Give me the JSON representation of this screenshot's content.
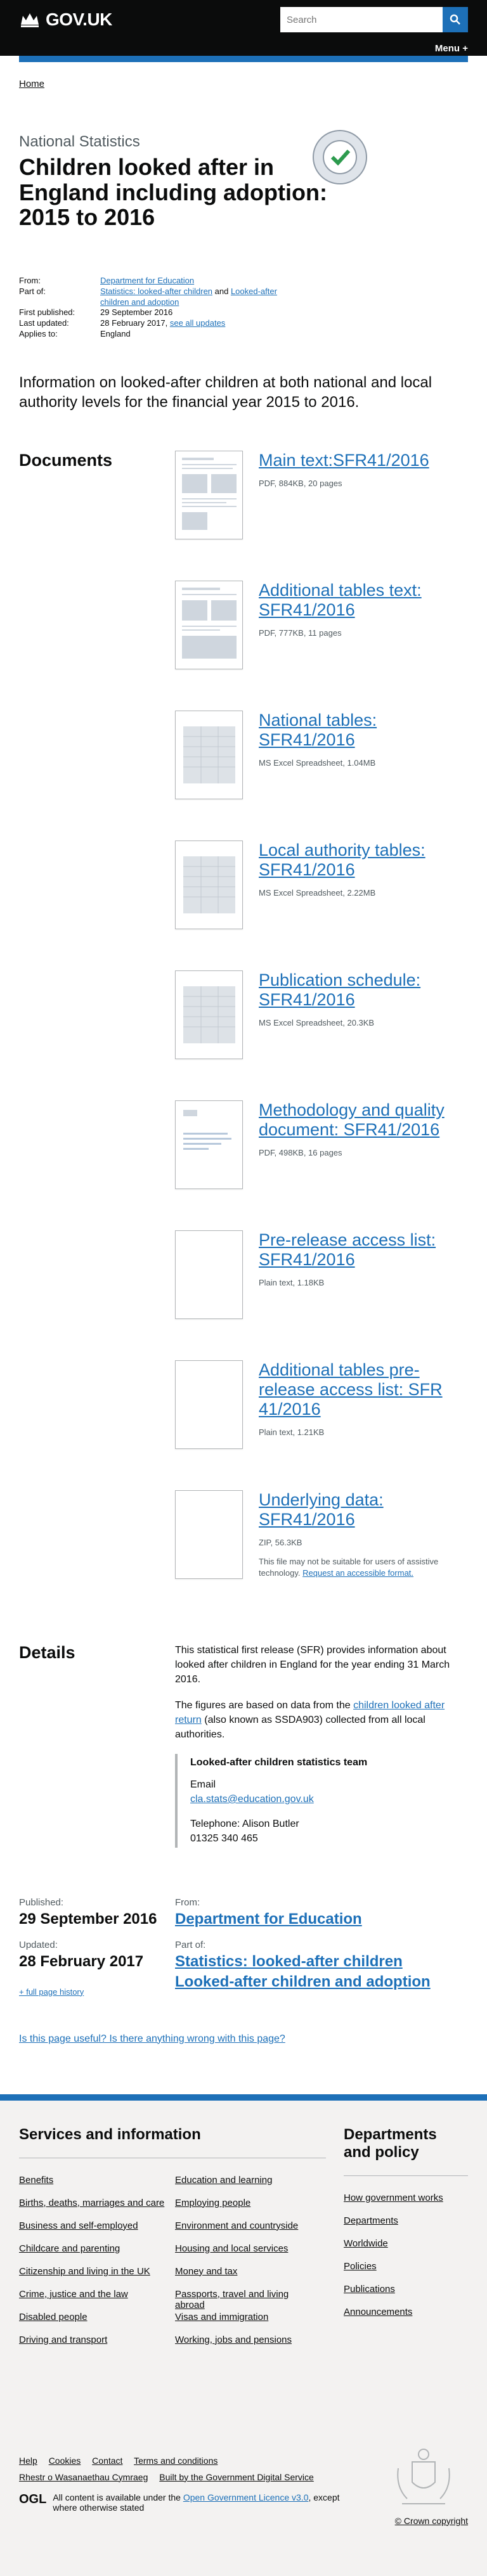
{
  "header": {
    "logo_text": "GOV.UK",
    "search_placeholder": "Search",
    "menu_label": "Menu +"
  },
  "breadcrumb": {
    "home": "Home"
  },
  "title": {
    "caption": "National Statistics",
    "heading": "Children looked after in England including adoption: 2015 to 2016",
    "badge_text": "NATIONAL STATISTICS"
  },
  "meta": {
    "from_label": "From:",
    "from_value": "Department for Education",
    "partof_label": "Part of:",
    "partof_value_1": "Statistics: looked-after children",
    "partof_and": " and ",
    "partof_value_2": "Looked-after children and adoption",
    "first_published_label": "First published:",
    "first_published_value": "29 September 2016",
    "last_updated_label": "Last updated:",
    "last_updated_value": "28 February 2017,",
    "see_all_updates": "see all updates",
    "applies_to_label": "Applies to:",
    "applies_to_value": "England"
  },
  "lede": "Information on looked-after children at both national and local authority levels for the financial year 2015 to 2016.",
  "documents": {
    "heading": "Documents",
    "items": [
      {
        "title": "Main text:SFR41/2016",
        "meta": "PDF, 884KB, 20 pages",
        "extra": ""
      },
      {
        "title": "Additional tables text: SFR41/2016",
        "meta": "PDF, 777KB, 11 pages",
        "extra": ""
      },
      {
        "title": "National tables: SFR41/2016",
        "meta": "MS Excel Spreadsheet, 1.04MB",
        "extra": ""
      },
      {
        "title": "Local authority tables: SFR41/2016",
        "meta": "MS Excel Spreadsheet, 2.22MB",
        "extra": ""
      },
      {
        "title": "Publication schedule: SFR41/2016",
        "meta": "MS Excel Spreadsheet, 20.3KB",
        "extra": ""
      },
      {
        "title": "Methodology and quality document: SFR41/2016",
        "meta": "PDF, 498KB, 16 pages",
        "extra": ""
      },
      {
        "title": "Pre-release access list: SFR41/2016",
        "meta": "Plain text, 1.18KB",
        "extra": ""
      },
      {
        "title": "Additional tables pre-release access list: SFR 41/2016",
        "meta": "Plain text, 1.21KB",
        "extra": ""
      },
      {
        "title": "Underlying data: SFR41/2016",
        "meta": "ZIP, 56.3KB",
        "extra": "This file may not be suitable for users of assistive technology.",
        "extra_link": "Request an accessible format."
      }
    ]
  },
  "details": {
    "heading": "Details",
    "para1": "This statistical first release (SFR) provides information about looked after children in England for the year ending 31 March 2016.",
    "para2_a": "The figures are based on data from the ",
    "para2_link": "children looked after return",
    "para2_b": " (also known as SSDA903) collected from all local authorities.",
    "contact_title": "Looked-after children statistics team",
    "email_label": "Email",
    "email": "cla.stats@education.gov.uk",
    "telephone": "Telephone: Alison Butler",
    "phone": "01325 340 465"
  },
  "published": {
    "published_label": "Published:",
    "published_value": "29 September 2016",
    "updated_label": "Updated:",
    "updated_value": "28 February 2017",
    "history_link": "+ full page history",
    "from_label": "From:",
    "from_value": "Department for Education",
    "partof_label": "Part of:",
    "partof_1": "Statistics: looked-after children",
    "partof_2": "Looked-after children and adoption"
  },
  "feedback": "Is this page useful?    Is there anything wrong with this page?",
  "footer": {
    "col1_heading": "Services and information",
    "col1a": [
      "Benefits",
      "Births, deaths, marriages and care",
      "Business and self-employed",
      "Childcare and parenting",
      "Citizenship and living in the UK",
      "Crime, justice and the law",
      "Disabled people",
      "Driving and transport"
    ],
    "col1b": [
      "Education and learning",
      "Employing people",
      "Environment and countryside",
      "Housing and local services",
      "Money and tax",
      "Passports, travel and living abroad",
      "Visas and immigration",
      "Working, jobs and pensions"
    ],
    "col2_heading": "Departments and policy",
    "col2": [
      "How government works",
      "Departments",
      "Worldwide",
      "Policies",
      "Publications",
      "Announcements"
    ],
    "meta_links": [
      "Help",
      "Cookies",
      "Contact",
      "Terms and conditions",
      "Rhestr o Wasanaethau Cymraeg",
      "Built by the Government Digital Service"
    ],
    "ogl_mark": "OGL",
    "ogl_text_a": "All content is available under the ",
    "ogl_link": "Open Government Licence v3.0",
    "ogl_text_b": ", except where otherwise stated",
    "copyright": "© Crown copyright"
  }
}
